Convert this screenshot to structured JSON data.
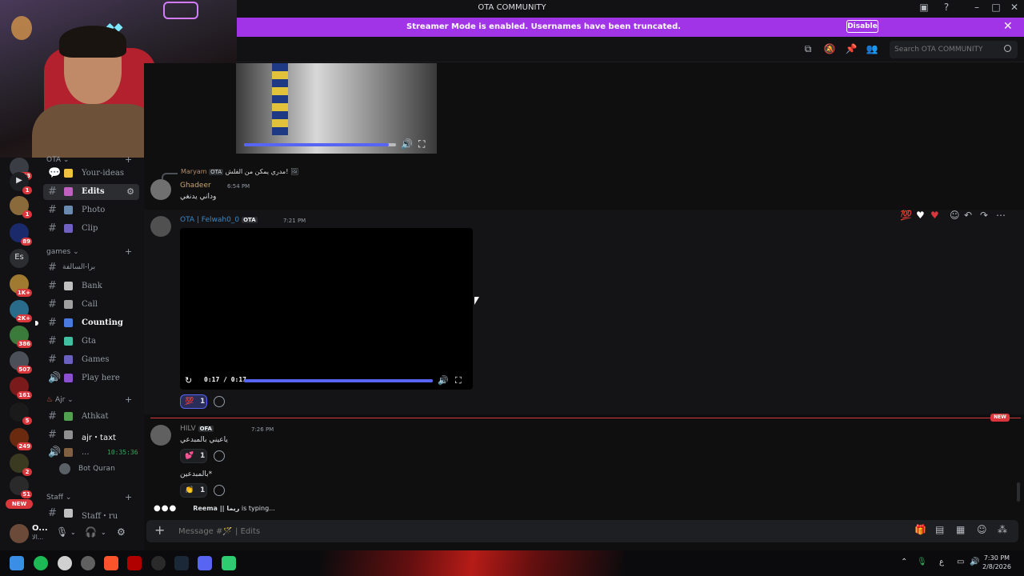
{
  "titlebar": {
    "title": "OTA COMMUNITY"
  },
  "banner": {
    "text": "Streamer Mode is enabled. Usernames have been truncated.",
    "disable_label": "Disable",
    "color": "#a234e8"
  },
  "header": {
    "search_placeholder": "Search OTA COMMUNITY",
    "icons": [
      "threads-icon",
      "mute-bell-icon",
      "pin-icon",
      "members-icon"
    ]
  },
  "servers": [
    {
      "label": "",
      "badge": "133"
    },
    {
      "label": "",
      "badge": "1"
    },
    {
      "label": "",
      "badge": "1"
    },
    {
      "label": "",
      "badge": "89"
    },
    {
      "label": "Es",
      "badge": ""
    },
    {
      "label": "",
      "badge": "1K+"
    },
    {
      "label": "",
      "badge": "2K+"
    },
    {
      "label": "",
      "badge": "386"
    },
    {
      "label": "",
      "badge": "507"
    },
    {
      "label": "",
      "badge": "161"
    },
    {
      "label": "",
      "badge": "5"
    },
    {
      "label": "",
      "badge": "249"
    },
    {
      "label": "",
      "badge": "2"
    },
    {
      "label": "",
      "badge": "51"
    }
  ],
  "servers_new": "NEW",
  "sidebar": {
    "categories": [
      {
        "name": "OTA"
      },
      {
        "name": "games"
      },
      {
        "name": "Ajr"
      },
      {
        "name": "Staff"
      }
    ],
    "channels": [
      {
        "name": "Your-ideas"
      },
      {
        "name": "Edits"
      },
      {
        "name": "Photo"
      },
      {
        "name": "Clip"
      },
      {
        "name": "برا-السالفة"
      },
      {
        "name": "Bank"
      },
      {
        "name": "Call"
      },
      {
        "name": "Counting"
      },
      {
        "name": "Gta"
      },
      {
        "name": "Games"
      },
      {
        "name": "Play here"
      },
      {
        "name": "Athkat"
      },
      {
        "name": "ajr・taxt"
      },
      {
        "name": "..."
      },
      {
        "name": "Staff・ru"
      }
    ],
    "voice_time": "10:35:36",
    "bot_name": "Bot Quran"
  },
  "user": {
    "name": "O...",
    "status": "الا..."
  },
  "chat": {
    "reply": {
      "name": "Maryam",
      "tag": "OTA",
      "text": "مدري يمكن من الفلش!"
    },
    "msg1": {
      "name": "Ghadeer",
      "time": "6:54 PM",
      "text": "وداني يدنغي"
    },
    "msg2": {
      "name": "OTA | Felwah0_0",
      "tag": "OTA",
      "time": "7:21 PM",
      "video_time": "0:17 / 0:17",
      "video_progress": 1.0,
      "reaction_emoji": "💯",
      "reaction_count": "1"
    },
    "new_label": "NEW",
    "msg3": {
      "name": "HILV",
      "tag": "OFA",
      "time": "7:26 PM",
      "text": "ياعيني بالمبدعي",
      "reaction_count": "1",
      "text2": "بالمبدعين*",
      "reaction2_count": "1"
    },
    "typing": {
      "user": "Reema || ريما",
      "suffix": " is typing..."
    },
    "top_video_progress": 0.95
  },
  "composer": {
    "placeholder": "Message #🪄 | Edits"
  },
  "taskbar": {
    "time": "7:30 PM",
    "date": "2/8/2026",
    "lang": "ع"
  }
}
